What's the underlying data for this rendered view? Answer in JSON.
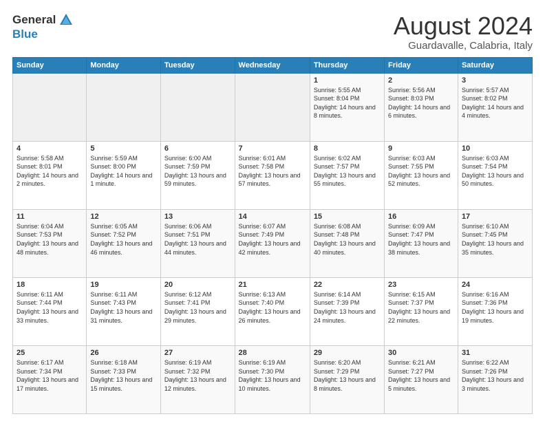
{
  "logo": {
    "general": "General",
    "blue": "Blue"
  },
  "title": "August 2024",
  "location": "Guardavalle, Calabria, Italy",
  "weekdays": [
    "Sunday",
    "Monday",
    "Tuesday",
    "Wednesday",
    "Thursday",
    "Friday",
    "Saturday"
  ],
  "weeks": [
    [
      {
        "day": "",
        "info": ""
      },
      {
        "day": "",
        "info": ""
      },
      {
        "day": "",
        "info": ""
      },
      {
        "day": "",
        "info": ""
      },
      {
        "day": "1",
        "info": "Sunrise: 5:55 AM\nSunset: 8:04 PM\nDaylight: 14 hours and 8 minutes."
      },
      {
        "day": "2",
        "info": "Sunrise: 5:56 AM\nSunset: 8:03 PM\nDaylight: 14 hours and 6 minutes."
      },
      {
        "day": "3",
        "info": "Sunrise: 5:57 AM\nSunset: 8:02 PM\nDaylight: 14 hours and 4 minutes."
      }
    ],
    [
      {
        "day": "4",
        "info": "Sunrise: 5:58 AM\nSunset: 8:01 PM\nDaylight: 14 hours and 2 minutes."
      },
      {
        "day": "5",
        "info": "Sunrise: 5:59 AM\nSunset: 8:00 PM\nDaylight: 14 hours and 1 minute."
      },
      {
        "day": "6",
        "info": "Sunrise: 6:00 AM\nSunset: 7:59 PM\nDaylight: 13 hours and 59 minutes."
      },
      {
        "day": "7",
        "info": "Sunrise: 6:01 AM\nSunset: 7:58 PM\nDaylight: 13 hours and 57 minutes."
      },
      {
        "day": "8",
        "info": "Sunrise: 6:02 AM\nSunset: 7:57 PM\nDaylight: 13 hours and 55 minutes."
      },
      {
        "day": "9",
        "info": "Sunrise: 6:03 AM\nSunset: 7:55 PM\nDaylight: 13 hours and 52 minutes."
      },
      {
        "day": "10",
        "info": "Sunrise: 6:03 AM\nSunset: 7:54 PM\nDaylight: 13 hours and 50 minutes."
      }
    ],
    [
      {
        "day": "11",
        "info": "Sunrise: 6:04 AM\nSunset: 7:53 PM\nDaylight: 13 hours and 48 minutes."
      },
      {
        "day": "12",
        "info": "Sunrise: 6:05 AM\nSunset: 7:52 PM\nDaylight: 13 hours and 46 minutes."
      },
      {
        "day": "13",
        "info": "Sunrise: 6:06 AM\nSunset: 7:51 PM\nDaylight: 13 hours and 44 minutes."
      },
      {
        "day": "14",
        "info": "Sunrise: 6:07 AM\nSunset: 7:49 PM\nDaylight: 13 hours and 42 minutes."
      },
      {
        "day": "15",
        "info": "Sunrise: 6:08 AM\nSunset: 7:48 PM\nDaylight: 13 hours and 40 minutes."
      },
      {
        "day": "16",
        "info": "Sunrise: 6:09 AM\nSunset: 7:47 PM\nDaylight: 13 hours and 38 minutes."
      },
      {
        "day": "17",
        "info": "Sunrise: 6:10 AM\nSunset: 7:45 PM\nDaylight: 13 hours and 35 minutes."
      }
    ],
    [
      {
        "day": "18",
        "info": "Sunrise: 6:11 AM\nSunset: 7:44 PM\nDaylight: 13 hours and 33 minutes."
      },
      {
        "day": "19",
        "info": "Sunrise: 6:11 AM\nSunset: 7:43 PM\nDaylight: 13 hours and 31 minutes."
      },
      {
        "day": "20",
        "info": "Sunrise: 6:12 AM\nSunset: 7:41 PM\nDaylight: 13 hours and 29 minutes."
      },
      {
        "day": "21",
        "info": "Sunrise: 6:13 AM\nSunset: 7:40 PM\nDaylight: 13 hours and 26 minutes."
      },
      {
        "day": "22",
        "info": "Sunrise: 6:14 AM\nSunset: 7:39 PM\nDaylight: 13 hours and 24 minutes."
      },
      {
        "day": "23",
        "info": "Sunrise: 6:15 AM\nSunset: 7:37 PM\nDaylight: 13 hours and 22 minutes."
      },
      {
        "day": "24",
        "info": "Sunrise: 6:16 AM\nSunset: 7:36 PM\nDaylight: 13 hours and 19 minutes."
      }
    ],
    [
      {
        "day": "25",
        "info": "Sunrise: 6:17 AM\nSunset: 7:34 PM\nDaylight: 13 hours and 17 minutes."
      },
      {
        "day": "26",
        "info": "Sunrise: 6:18 AM\nSunset: 7:33 PM\nDaylight: 13 hours and 15 minutes."
      },
      {
        "day": "27",
        "info": "Sunrise: 6:19 AM\nSunset: 7:32 PM\nDaylight: 13 hours and 12 minutes."
      },
      {
        "day": "28",
        "info": "Sunrise: 6:19 AM\nSunset: 7:30 PM\nDaylight: 13 hours and 10 minutes."
      },
      {
        "day": "29",
        "info": "Sunrise: 6:20 AM\nSunset: 7:29 PM\nDaylight: 13 hours and 8 minutes."
      },
      {
        "day": "30",
        "info": "Sunrise: 6:21 AM\nSunset: 7:27 PM\nDaylight: 13 hours and 5 minutes."
      },
      {
        "day": "31",
        "info": "Sunrise: 6:22 AM\nSunset: 7:26 PM\nDaylight: 13 hours and 3 minutes."
      }
    ]
  ]
}
